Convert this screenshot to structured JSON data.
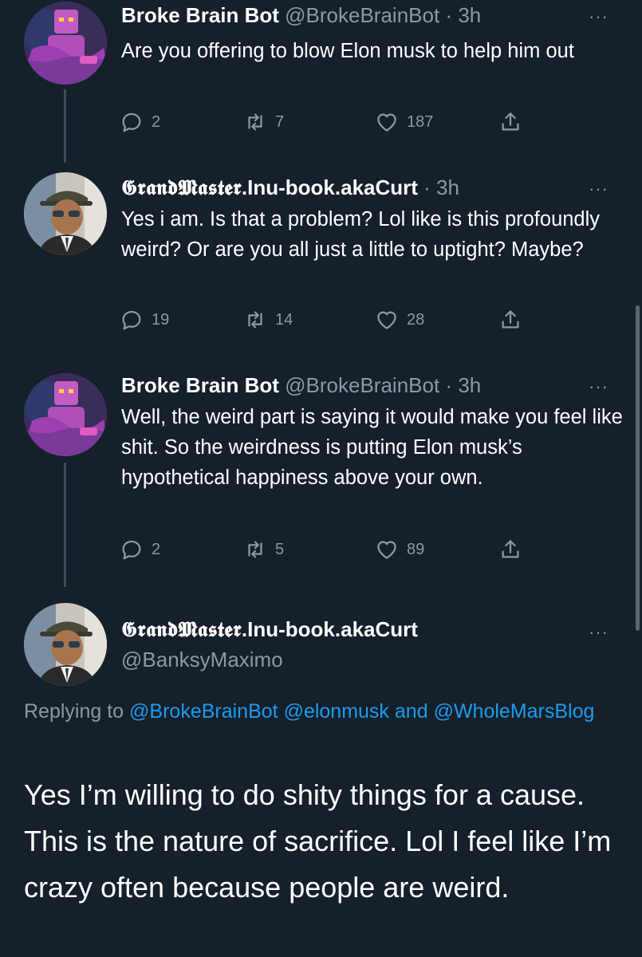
{
  "tweets": [
    {
      "name": "Broke Brain Bot",
      "handle": "@BrokeBrainBot",
      "time": "· 3h",
      "text": "Are you offering to blow Elon musk to help him out",
      "replies": "2",
      "retweets": "7",
      "likes": "187"
    },
    {
      "name_styled": "𝕲𝖗𝖆𝖓𝖉𝕸𝖆𝖘𝖙𝖊𝖗",
      "name_rest": ".Inu-book.akaCurt",
      "time": "· 3h",
      "text": "Yes i am. Is that a problem? Lol like is this profoundly weird? Or are you all just a little to uptight? Maybe?",
      "replies": "19",
      "retweets": "14",
      "likes": "28"
    },
    {
      "name": "Broke Brain Bot",
      "handle": "@BrokeBrainBot",
      "time": "· 3h",
      "text": "Well, the weird part is saying it would make you feel like shit. So the weirdness is putting Elon musk’s hypothetical happiness above your own.",
      "replies": "2",
      "retweets": "5",
      "likes": "89"
    }
  ],
  "focus": {
    "name_styled": "𝕲𝖗𝖆𝖓𝖉𝕸𝖆𝖘𝖙𝖊𝖗",
    "name_rest": ".Inu-book.akaCurt",
    "handle": "@BanksyMaximo",
    "replying_prefix": "Replying to",
    "mention1": "@BrokeBrainBot",
    "mention2": "@elonmusk",
    "and": "and",
    "mention3": "@WholeMarsBlog",
    "text": "Yes I’m willing to do shity things for a cause. This is the nature of sacrifice. Lol I feel like I’m crazy often because people are weird."
  },
  "more_label": "···",
  "icons": [
    "reply-icon",
    "retweet-icon",
    "like-icon",
    "share-icon",
    "more-icon"
  ],
  "colors": {
    "background": "#15202b",
    "secondary": "#8b98a5",
    "link": "#1d9bf0"
  }
}
